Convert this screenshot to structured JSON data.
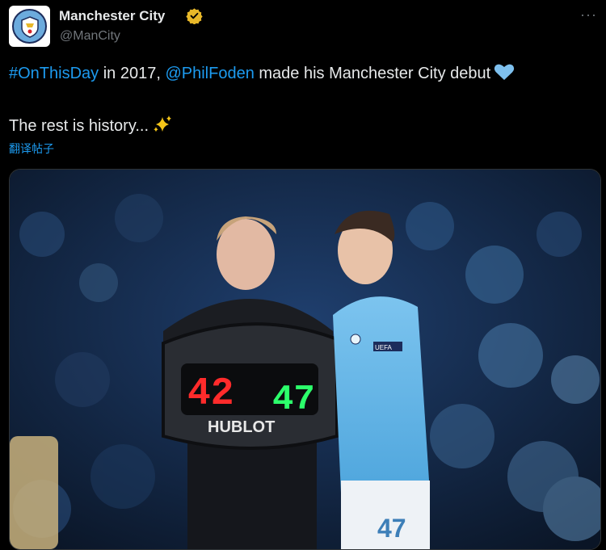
{
  "author": {
    "name": "Manchester City",
    "handle": "@ManCity",
    "avatar_icon": "man-city-crest-icon",
    "verified_icon": "verified-gold-badge-icon"
  },
  "tweet": {
    "hashtag": "#OnThisDay",
    "text_1": " in 2017, ",
    "mention": "@PhilFoden",
    "text_2": " made his Manchester City debut",
    "line_2": "The rest is history...",
    "translate_label": "翻译帖子"
  },
  "more_label": "···",
  "image": {
    "board_digits_red": "42",
    "board_digits_green": "47",
    "board_brand": "HUBLOT",
    "shirt_number": "47",
    "sleeve_patch": "UEFA"
  },
  "colors": {
    "link": "#1d9bf0",
    "muted": "#71767b",
    "city_blue": "#6cabdd",
    "verified_gold": "#e8b829"
  }
}
